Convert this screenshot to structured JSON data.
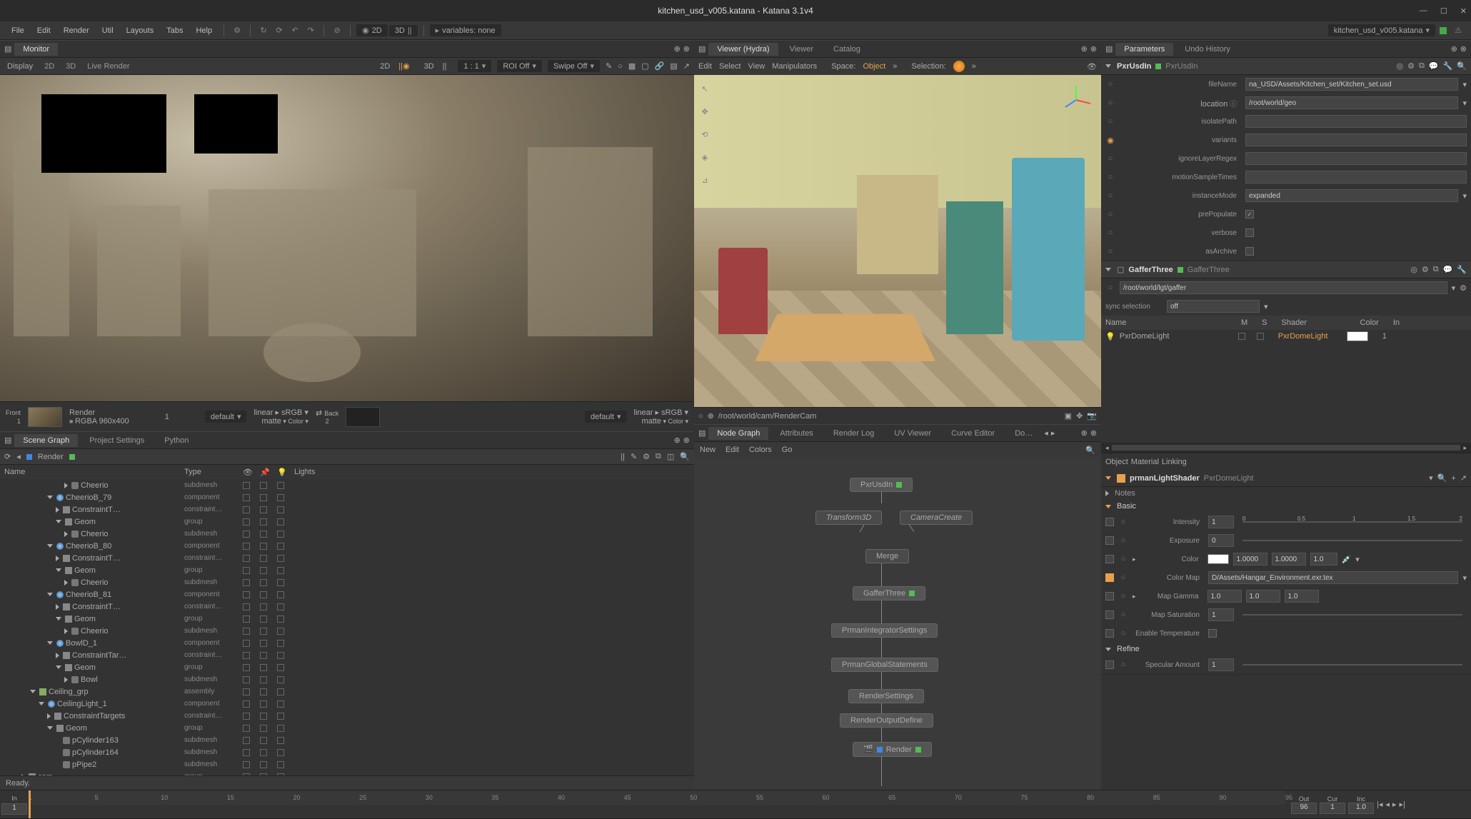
{
  "window": {
    "title": "kitchen_usd_v005.katana - Katana 3.1v4",
    "filename_pill": "kitchen_usd_v005.katana"
  },
  "menubar": {
    "items": [
      "File",
      "Edit",
      "Render",
      "Util",
      "Layouts",
      "Tabs",
      "Help"
    ],
    "mode_2d": "2D",
    "mode_3d": "3D",
    "variables": "variables: none"
  },
  "monitor": {
    "tab": "Monitor",
    "toolbar": {
      "display": "Display",
      "b2d": "2D",
      "b3d": "3D",
      "live": "Live Render",
      "r2d": "2D",
      "r3d": "3D",
      "ratio": "1 : 1",
      "roi": "ROI Off",
      "swipe": "Swipe Off"
    },
    "strip": {
      "render": "Render",
      "one": "1",
      "front": "Front",
      "rgba": "RGBA  960x400",
      "default1": "default",
      "linear1": "linear",
      "srgb1": "sRGB",
      "matte1": "matte",
      "back": "Back",
      "two": "2",
      "default2": "default",
      "linear2": "linear",
      "srgb2": "sRGB",
      "matte2": "matte"
    }
  },
  "scenegraph": {
    "tabs": [
      "Scene Graph",
      "Project Settings",
      "Python"
    ],
    "breadcrumb": "Render",
    "cols": {
      "name": "Name",
      "type": "Type",
      "lights": "Lights"
    },
    "rows": [
      {
        "indent": 7,
        "tri": "right",
        "icon": "leaf",
        "name": "Cheerio",
        "type": "subdmesh"
      },
      {
        "indent": 5,
        "tri": "down",
        "icon": "sphere",
        "name": "CheerioB_79",
        "type": "component"
      },
      {
        "indent": 6,
        "tri": "right",
        "icon": "grp",
        "name": "ConstraintT…",
        "type": "constraint…"
      },
      {
        "indent": 6,
        "tri": "down",
        "icon": "grp",
        "name": "Geom",
        "type": "group"
      },
      {
        "indent": 7,
        "tri": "right",
        "icon": "leaf",
        "name": "Cheerio",
        "type": "subdmesh"
      },
      {
        "indent": 5,
        "tri": "down",
        "icon": "sphere",
        "name": "CheerioB_80",
        "type": "component"
      },
      {
        "indent": 6,
        "tri": "right",
        "icon": "grp",
        "name": "ConstraintT…",
        "type": "constraint…"
      },
      {
        "indent": 6,
        "tri": "down",
        "icon": "grp",
        "name": "Geom",
        "type": "group"
      },
      {
        "indent": 7,
        "tri": "right",
        "icon": "leaf",
        "name": "Cheerio",
        "type": "subdmesh"
      },
      {
        "indent": 5,
        "tri": "down",
        "icon": "sphere",
        "name": "CheerioB_81",
        "type": "component"
      },
      {
        "indent": 6,
        "tri": "right",
        "icon": "grp",
        "name": "ConstraintT…",
        "type": "constraint…"
      },
      {
        "indent": 6,
        "tri": "down",
        "icon": "grp",
        "name": "Geom",
        "type": "group"
      },
      {
        "indent": 7,
        "tri": "right",
        "icon": "leaf",
        "name": "Cheerio",
        "type": "subdmesh"
      },
      {
        "indent": 5,
        "tri": "down",
        "icon": "sphere",
        "name": "BowlD_1",
        "type": "component"
      },
      {
        "indent": 6,
        "tri": "right",
        "icon": "grp",
        "name": "ConstraintTar…",
        "type": "constraint…"
      },
      {
        "indent": 6,
        "tri": "down",
        "icon": "grp",
        "name": "Geom",
        "type": "group"
      },
      {
        "indent": 7,
        "tri": "right",
        "icon": "leaf",
        "name": "Bowl",
        "type": "subdmesh"
      },
      {
        "indent": 3,
        "tri": "down",
        "icon": "asm",
        "name": "Ceiling_grp",
        "type": "assembly"
      },
      {
        "indent": 4,
        "tri": "down",
        "icon": "sphere",
        "name": "CeilingLight_1",
        "type": "component"
      },
      {
        "indent": 5,
        "tri": "right",
        "icon": "grp",
        "name": "ConstraintTargets",
        "type": "constraint…"
      },
      {
        "indent": 5,
        "tri": "down",
        "icon": "grp",
        "name": "Geom",
        "type": "group"
      },
      {
        "indent": 6,
        "tri": "none",
        "icon": "leaf",
        "name": "pCylinder163",
        "type": "subdmesh"
      },
      {
        "indent": 6,
        "tri": "none",
        "icon": "leaf",
        "name": "pCylinder164",
        "type": "subdmesh"
      },
      {
        "indent": 6,
        "tri": "none",
        "icon": "leaf",
        "name": "pPipe2",
        "type": "subdmesh"
      },
      {
        "indent": 2,
        "tri": "right",
        "icon": "grp",
        "name": "cam",
        "type": "group"
      }
    ]
  },
  "status": {
    "ready": "Ready."
  },
  "viewer": {
    "tabs": [
      "Viewer (Hydra)",
      "Viewer",
      "Catalog"
    ],
    "toolbar": {
      "edit": "Edit",
      "select": "Select",
      "view": "View",
      "manip": "Manipulators",
      "space": "Space:",
      "object": "Object",
      "selection": "Selection:"
    },
    "campath": "/root/world/cam/RenderCam"
  },
  "nodegraph": {
    "tabs": [
      "Node Graph",
      "Attributes",
      "Render Log",
      "UV Viewer",
      "Curve Editor",
      "Do…"
    ],
    "menu": [
      "New",
      "Edit",
      "Colors",
      "Go"
    ],
    "nodes": {
      "pxrusdin": "PxrUsdIn",
      "transform": "Transform3D",
      "camera": "CameraCreate",
      "merge": "Merge",
      "gaffer": "GafferThree",
      "integrator": "PrmanIntegratorSettings",
      "globals": "PrmanGlobalStatements",
      "rendersettings": "RenderSettings",
      "outputdefine": "RenderOutputDefine",
      "render": "Render"
    }
  },
  "parameters": {
    "tabs": [
      "Parameters",
      "Undo History"
    ],
    "pxrusdin": {
      "title": "PxrUsdIn",
      "subtitle": "PxrUsdIn",
      "fields": {
        "fileName_label": "fileName",
        "fileName": "na_USD/Assets/Kitchen_set/Kitchen_set.usd",
        "location_label": "location",
        "location": "/root/world/geo",
        "isolatePath_label": "isolatePath",
        "variants_label": "variants",
        "ignoreLayerRegex_label": "ignoreLayerRegex",
        "motionSampleTimes_label": "motionSampleTimes",
        "instanceMode_label": "instanceMode",
        "instanceMode": "expanded",
        "prePopulate_label": "prePopulate",
        "verbose_label": "verbose",
        "asArchive_label": "asArchive"
      }
    },
    "gaffer": {
      "title": "GafferThree",
      "subtitle": "GafferThree",
      "path": "/root/world/lgt/gaffer",
      "syncsel_label": "sync selection",
      "syncsel": "off",
      "cols": {
        "name": "Name",
        "m": "M",
        "s": "S",
        "shader": "Shader",
        "color": "Color",
        "in": "In"
      },
      "light_name": "PxrDomeLight",
      "light_shader": "PxrDomeLight",
      "light_in": "1"
    },
    "subtabs": [
      "Object",
      "Material",
      "Linking"
    ],
    "shader": {
      "title": "prmanLightShader",
      "subtitle": "PxrDomeLight",
      "notes": "Notes",
      "basic": "Basic",
      "intensity_label": "Intensity",
      "intensity": "1",
      "exposure_label": "Exposure",
      "exposure": "0",
      "color_label": "Color",
      "color_r": "1.0000",
      "color_g": "1.0000",
      "color_b": "1.0",
      "colormap_label": "Color Map",
      "colormap": "D/Assets/Hangar_Environment.exr.tex",
      "mapgamma_label": "Map Gamma",
      "mapgamma_r": "1.0",
      "mapgamma_g": "1.0",
      "mapgamma_b": "1.0",
      "mapsat_label": "Map Saturation",
      "mapsat": "1",
      "enabletemp_label": "Enable Temperature",
      "refine": "Refine",
      "specular_label": "Specular Amount",
      "specular": "1",
      "slider_ticks": [
        "0",
        "0.5",
        "1",
        "1.5",
        "2"
      ]
    }
  },
  "timeline": {
    "in": "In",
    "out": "Out",
    "cur": "Cur",
    "inc": "Inc",
    "in_val": "1",
    "out_val": "96",
    "cur_val": "1",
    "inc_val": "1.0",
    "ticks": [
      "1",
      "5",
      "10",
      "15",
      "20",
      "25",
      "30",
      "35",
      "40",
      "45",
      "50",
      "55",
      "60",
      "65",
      "70",
      "75",
      "80",
      "85",
      "90",
      "95"
    ]
  }
}
